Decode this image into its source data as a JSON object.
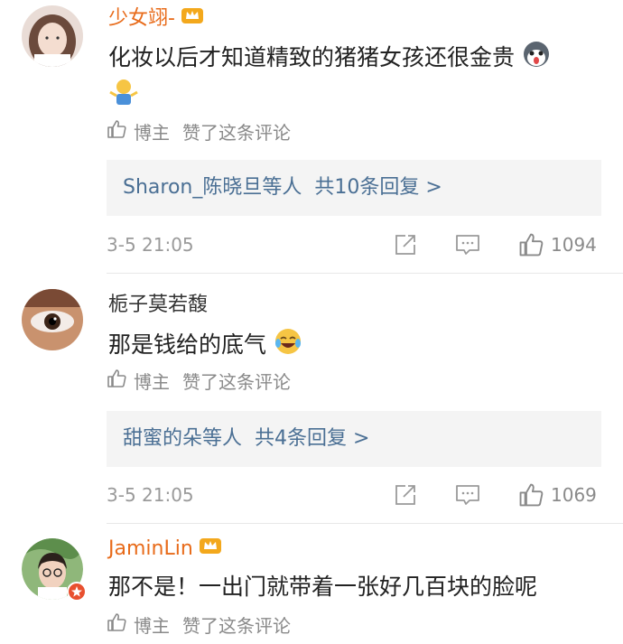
{
  "comments": [
    {
      "username": "少女翊-",
      "text": "化妆以后才知道精致的猪猪女孩还很金贵",
      "liked_author": "博主",
      "liked_text": "赞了这条评论",
      "reply_who": "Sharon_陈晓旦等人",
      "reply_count": "共10条回复 >",
      "time": "3-5 21:05",
      "likes": "1094"
    },
    {
      "username": "栀子莫若馥",
      "text": "那是钱给的底气",
      "liked_author": "博主",
      "liked_text": "赞了这条评论",
      "reply_who": "甜蜜的朵等人",
      "reply_count": "共4条回复 >",
      "time": "3-5 21:05",
      "likes": "1069"
    },
    {
      "username": "JaminLin",
      "text": "那不是！一出门就带着一张好几百块的脸呢",
      "liked_author": "博主",
      "liked_text": "赞了这条评论"
    }
  ],
  "colors": {
    "vip_name": "#e86b1a",
    "link": "#4a6f94",
    "meta": "#9a9a9a",
    "reply_bg": "#f4f4f4"
  },
  "icons": [
    "crown-icon",
    "thumb-up-icon",
    "share-icon",
    "comment-icon",
    "husky-emoji",
    "shrug-emoji",
    "laugh-cry-emoji"
  ]
}
